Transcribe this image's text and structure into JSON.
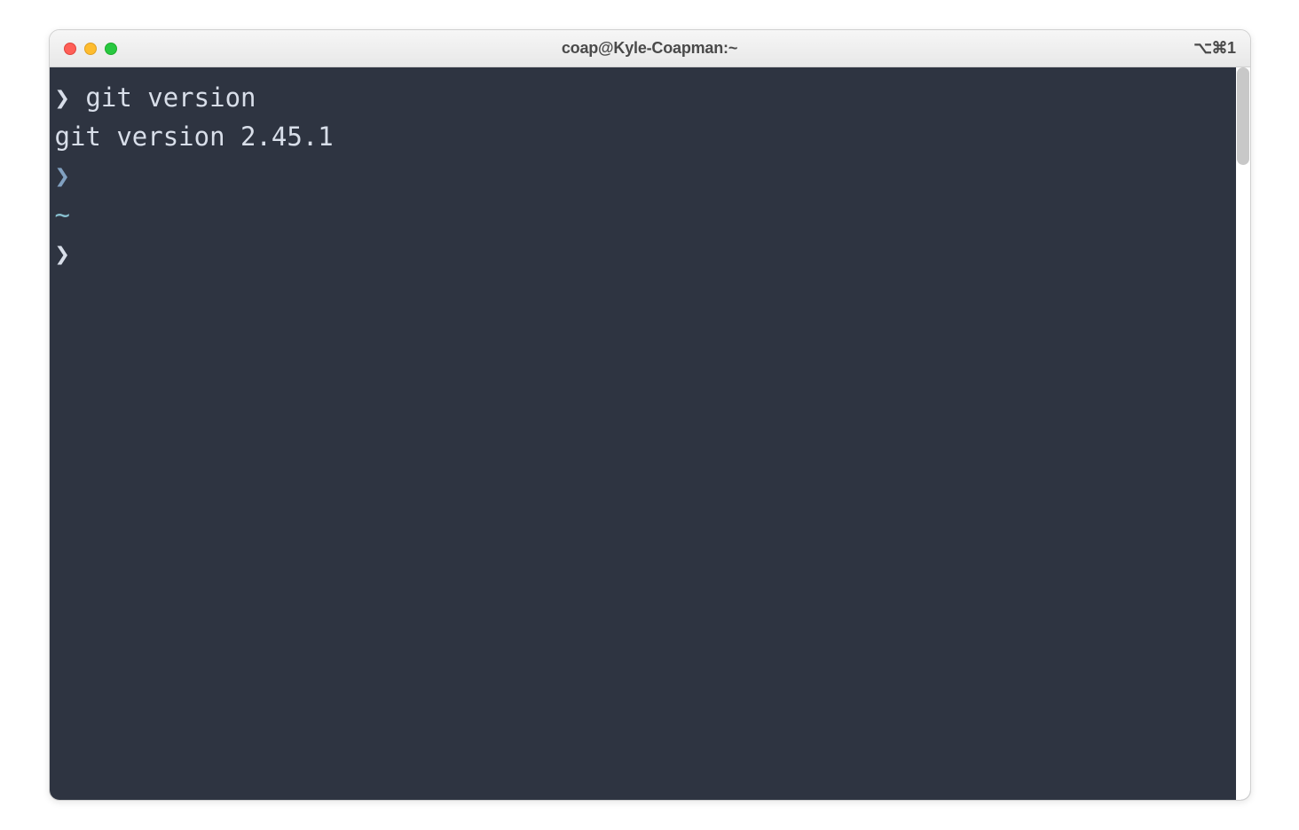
{
  "window": {
    "title": "coap@Kyle-Coapman:~",
    "shortcut_indicator": "⌥⌘1"
  },
  "traffic_lights": {
    "close": "close",
    "minimize": "minimize",
    "maximize": "maximize"
  },
  "terminal": {
    "lines": {
      "line1_prompt": "❯",
      "line1_command": " git version",
      "line2_output": "git version 2.45.1",
      "line3_cursor": "❯",
      "line4_blank": "",
      "line5_tilde": "~",
      "line6_prompt": "❯",
      "line6_rest": " "
    }
  }
}
